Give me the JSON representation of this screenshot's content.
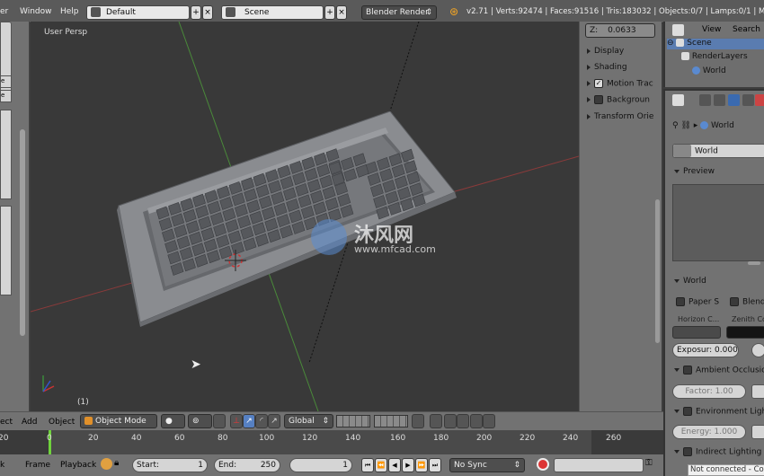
{
  "menu": {
    "items": [
      "er",
      "Window",
      "Help"
    ],
    "layout": "Default",
    "scene": "Scene",
    "engine": "Blender Render",
    "stats": "v2.71 | Verts:92474 | Faces:91516 | Tris:183032 | Objects:0/7 | Lamps:0/1 | Mem:14.4"
  },
  "viewport": {
    "label": "User Persp",
    "frame": "(1)",
    "watermark_cn": "沐风网",
    "watermark_url": "www.mfcad.com"
  },
  "npanel": {
    "z_label": "Z:",
    "z_value": "0.0633",
    "items": [
      "Display",
      "Shading",
      "Motion Trac",
      "Backgroun",
      "Transform Orie"
    ]
  },
  "outliner": {
    "view": "View",
    "search": "Search",
    "tree": [
      "Scene",
      "RenderLayers",
      "World"
    ]
  },
  "properties": {
    "crumb": "World",
    "world_field": "World",
    "preview": "Preview",
    "world_panel": "World",
    "paper_sky": "Paper S",
    "blend_sky": "Blend S",
    "horizon": "Horizon C...",
    "zenith": "Zenith Co",
    "exposure": "Exposur: 0.000",
    "ambient": "Ambient Occlusion",
    "factor": "Factor: 1.00",
    "env_light": "Environment Light",
    "energy": "Energy: 1.000",
    "indirect": "Indirect Lighting"
  },
  "view3d_header": {
    "items": [
      "ect",
      "Add",
      "Object"
    ],
    "mode": "Object Mode",
    "orientation": "Global"
  },
  "timeline": {
    "ticks": [
      "20",
      "0",
      "20",
      "40",
      "60",
      "80",
      "100",
      "120",
      "140",
      "160",
      "180",
      "200",
      "220",
      "240",
      "260"
    ],
    "menus": [
      "k",
      "Frame",
      "Playback"
    ],
    "start": "Start:",
    "start_val": "1",
    "end": "End:",
    "end_val": "250",
    "current": "1",
    "sync": "No Sync"
  },
  "status": {
    "text": "Not connected - Co"
  },
  "colors": {
    "accent": "#5680c2",
    "x_axis": "#a33a3a",
    "y_axis": "#4a8a3a",
    "keyboard": "#8a8c90"
  }
}
